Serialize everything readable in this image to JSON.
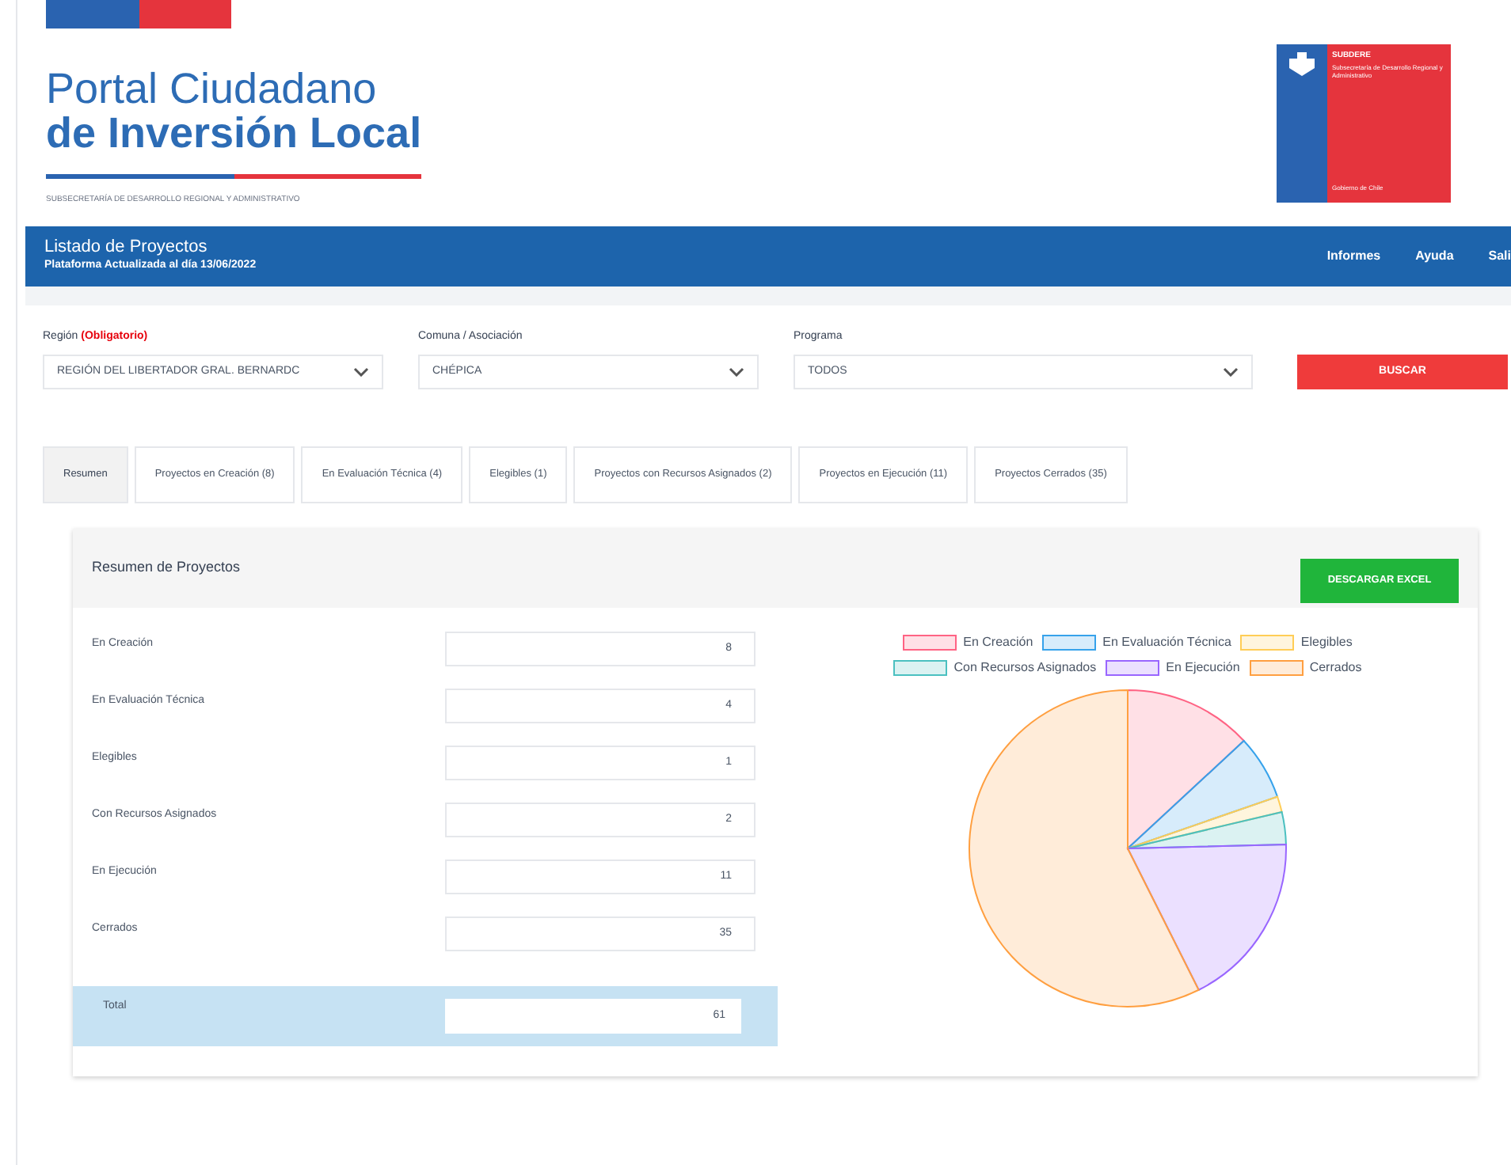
{
  "header": {
    "title_line_1": "Portal Ciudadano",
    "title_line_2": "de Inversión Local",
    "subtitle": "SUBSECRETARÍA DE DESARROLLO REGIONAL Y ADMINISTRATIVO",
    "logo": {
      "name": "SUBDERE",
      "text": "Subsecretaría de Desarrollo Regional y Administrativo",
      "footer": "Gobierno de Chile"
    }
  },
  "nav_bar": {
    "title": "Listado de Proyectos",
    "subtitle": "Plataforma Actualizada al día 13/06/2022",
    "links": [
      "Informes",
      "Ayuda",
      "Sali"
    ]
  },
  "filters": [
    {
      "label": "Región",
      "required_note": "(Obligatorio)",
      "value": "REGIÓN DEL LIBERTADOR GRAL. BERNARDC"
    },
    {
      "label": "Comuna / Asociación",
      "value": "CHÉPICA"
    },
    {
      "label": "Programa",
      "value": "TODOS"
    }
  ],
  "search_button": "BUSCAR",
  "tabs": [
    {
      "label": "Resumen",
      "selected": true
    },
    {
      "label": "Proyectos en Creación (8)",
      "selected": false
    },
    {
      "label": "En Evaluación Técnica (4)",
      "selected": false
    },
    {
      "label": "Elegibles (1)",
      "selected": false
    },
    {
      "label": "Proyectos con Recursos Asignados (2)",
      "selected": false
    },
    {
      "label": "Proyectos en Ejecución (11)",
      "selected": false
    },
    {
      "label": "Proyectos Cerrados (35)",
      "selected": false
    }
  ],
  "summary": {
    "title": "Resumen de Proyectos",
    "download_button": "DESCARGAR EXCEL",
    "rows": [
      {
        "label": "En Creación",
        "value": "8"
      },
      {
        "label": "En Evaluación Técnica",
        "value": "4"
      },
      {
        "label": "Elegibles",
        "value": "1"
      },
      {
        "label": "Con Recursos Asignados",
        "value": "2"
      },
      {
        "label": "En Ejecución",
        "value": "11"
      },
      {
        "label": "Cerrados",
        "value": "35"
      }
    ],
    "total": {
      "label": "Total",
      "value": "61"
    },
    "chart_data": {
      "type": "pie",
      "categories": [
        "En Creación",
        "En Evaluación Técnica",
        "Elegibles",
        "Con Recursos Asignados",
        "En Ejecución",
        "Cerrados"
      ],
      "values": [
        13.1,
        6.6,
        1.6,
        3.3,
        18.0,
        57.4
      ],
      "colors": [
        "#ff6384",
        "#36a2eb",
        "#ffcd56",
        "#4bc0c0",
        "#9966ff",
        "#ff9f40"
      ],
      "legend": true
    }
  }
}
